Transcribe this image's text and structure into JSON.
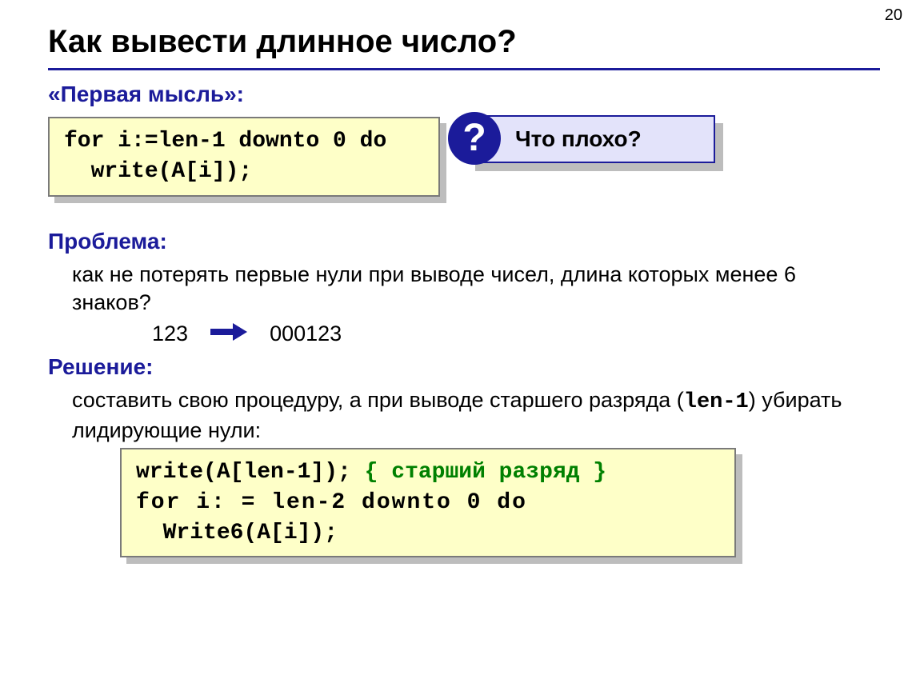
{
  "pageNumber": "20",
  "title": "Как вывести длинное число?",
  "labels": {
    "firstThought": "«Первая мысль»:",
    "problem": "Проблема:",
    "solution": "Решение:"
  },
  "callout": {
    "mark": "?",
    "text": "Что плохо?"
  },
  "code1": {
    "line1": "for i:=len-1 downto 0 do",
    "line2": "  write(A[i]);"
  },
  "problemText": "как не потерять первые нули при выводе чисел, длина которых менее 6 знаков?",
  "example": {
    "from": "123",
    "to": "000123"
  },
  "solutionText": {
    "part1": "составить свою процедуру, а при выводе старшего разряда (",
    "code": "len-1",
    "part2": ") убирать лидирующие нули:"
  },
  "code2": {
    "line1a": "write(A[len-1]); ",
    "line1b": "{ старший разряд }",
    "line2": "for i: = len-2 downto 0 do",
    "line3": "  Write6(A[i]);"
  }
}
